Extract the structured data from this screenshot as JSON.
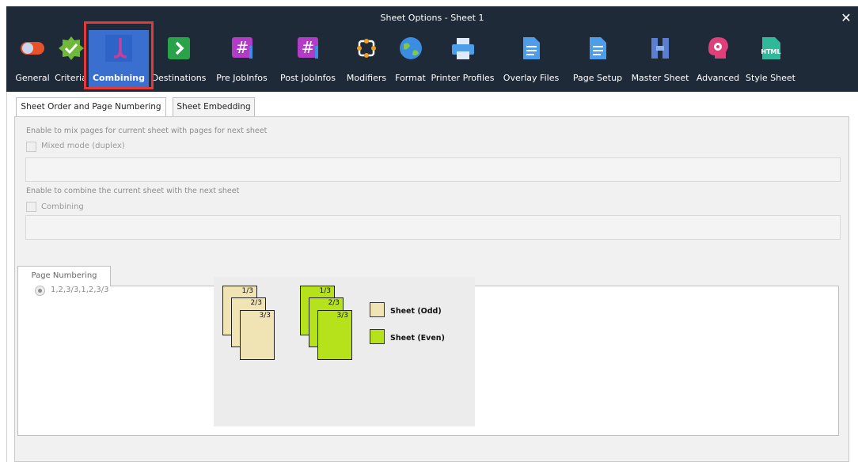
{
  "window": {
    "title": "Sheet Options - Sheet 1",
    "close_glyph": "✕"
  },
  "toolbar": {
    "active": "Combining",
    "items": [
      {
        "label": "General",
        "icon": "toggle-icon",
        "color": "#e8522b"
      },
      {
        "label": "Criteria",
        "icon": "check-badge-icon",
        "color": "#6fb83a"
      },
      {
        "label": "Combining",
        "icon": "combine-icon",
        "color": "#c3409c"
      },
      {
        "label": "Destinations",
        "icon": "arrow-right-icon",
        "color": "#2aa24a"
      },
      {
        "label": "Pre JobInfos",
        "icon": "hash-up-icon",
        "color": "#b33cc6"
      },
      {
        "label": "Post JobInfos",
        "icon": "hash-down-icon",
        "color": "#b33cc6"
      },
      {
        "label": "Modifiers",
        "icon": "modifier-icon",
        "color": "#f0a020"
      },
      {
        "label": "Format",
        "icon": "globe-icon",
        "color": "#3a8de0"
      },
      {
        "label": "Printer Profiles",
        "icon": "printer-icon",
        "color": "#4e9de8"
      },
      {
        "label": "Overlay Files",
        "icon": "document-icon",
        "color": "#4e9de8"
      },
      {
        "label": "Page Setup",
        "icon": "page-icon",
        "color": "#4e9de8"
      },
      {
        "label": "Master Sheet",
        "icon": "master-sheet-icon",
        "color": "#5b7fd0"
      },
      {
        "label": "Advanced",
        "icon": "head-gear-icon",
        "color": "#e0407a"
      },
      {
        "label": "Style Sheet",
        "icon": "html-icon",
        "color": "#2fb89a"
      }
    ]
  },
  "tabs": {
    "active": "Sheet Order and Page Numbering",
    "items": [
      "Sheet Order and Page Numbering",
      "Sheet Embedding"
    ]
  },
  "mixed": {
    "hint": "Enable to mix pages for current sheet with pages for next sheet",
    "checkbox_label": "Mixed mode (duplex)",
    "checked": false,
    "value": ""
  },
  "combining": {
    "hint": "Enable to combine the current sheet with the next sheet",
    "checkbox_label": "Combining",
    "checked": false,
    "value": ""
  },
  "page_numbering": {
    "tab_label": "Page Numbering",
    "option": "1,2,3/3,1,2,3/3",
    "odd_pages": [
      "1/3",
      "2/3",
      "3/3"
    ],
    "even_pages": [
      "1/3",
      "2/3",
      "3/3"
    ],
    "legend_odd": "Sheet (Odd)",
    "legend_even": "Sheet (Even)",
    "odd_color": "#f0e3b4",
    "even_color": "#b6e21c"
  }
}
